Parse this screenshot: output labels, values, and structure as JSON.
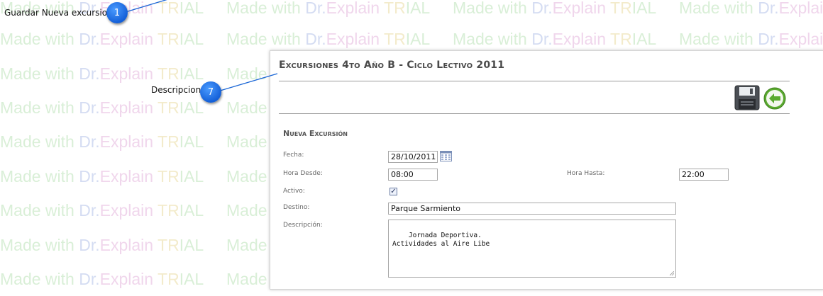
{
  "watermark": {
    "prefix": "Made with ",
    "brand_dr": "Dr.",
    "brand_explain": "Explain",
    "suffix_tr": " TR",
    "suffix_ial": "IAL"
  },
  "callouts": [
    {
      "number": "1",
      "label": "Guardar Nueva excursion"
    },
    {
      "number": "7",
      "label": "Descripcion"
    }
  ],
  "page": {
    "title": "Excursiones 4to Año B - Ciclo Lectivo 2011"
  },
  "toolbar": {
    "save_icon": "floppy-disk-icon",
    "back_icon": "arrow-left-circle-icon"
  },
  "form": {
    "section_title": "Nueva Excursión",
    "fecha_label": "Fecha:",
    "fecha_value": "28/10/2011",
    "hora_desde_label": "Hora Desde:",
    "hora_desde_value": "08:00",
    "hora_hasta_label": "Hora Hasta:",
    "hora_hasta_value": "22:00",
    "activo_label": "Activo:",
    "activo_checked": true,
    "activo_mark": "✓",
    "destino_label": "Destino:",
    "destino_value": "Parque Sarmiento",
    "descripcion_label": "Descripción:",
    "descripcion_value": "Jornada Deportiva.\nActividades al Aire Libe"
  },
  "colors": {
    "badge": "#1460d8",
    "callout_line": "#1a66d6",
    "back_button": "#5aaa2f"
  }
}
